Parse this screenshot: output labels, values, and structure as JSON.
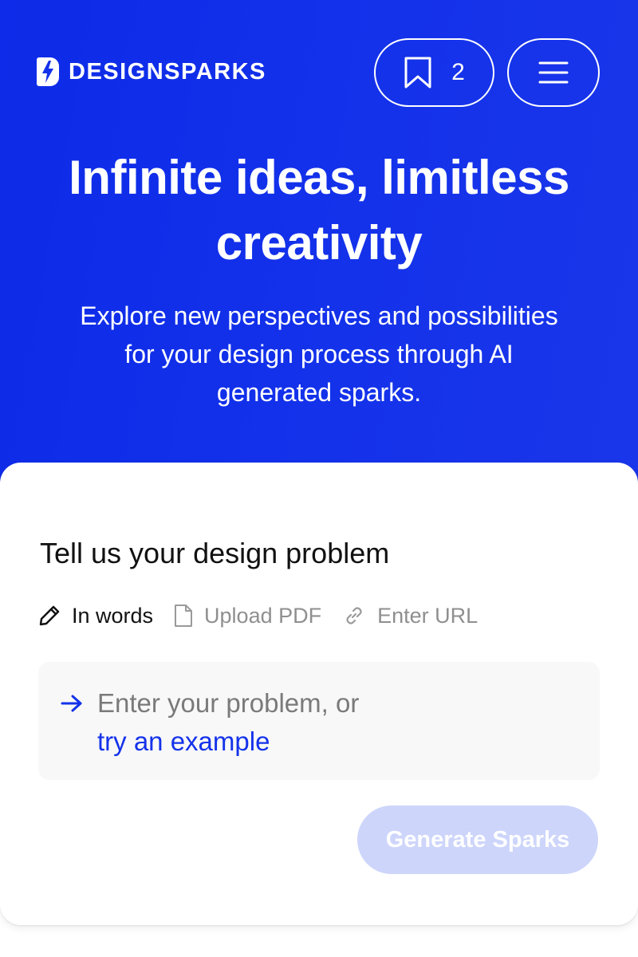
{
  "header": {
    "logo_text": "DESIGNSPARKS",
    "logo_icon": "lightning-bolt-icon",
    "saved_icon": "bookmark-icon",
    "saved_count": "2",
    "menu_icon": "hamburger-menu-icon"
  },
  "hero": {
    "title_line1": "Infinite ideas, limitless",
    "title_line2": "creativity",
    "subtitle_line1": "Explore new perspectives and possibilities",
    "subtitle_line2": "for your design process through AI",
    "subtitle_line3": "generated sparks."
  },
  "form": {
    "heading": "Tell us your design problem",
    "tabs": [
      {
        "label": "In words",
        "icon": "pencil-icon",
        "active": true
      },
      {
        "label": "Upload PDF",
        "icon": "document-icon",
        "active": false
      },
      {
        "label": "Enter URL",
        "icon": "link-icon",
        "active": false
      }
    ],
    "input_icon": "arrow-right-icon",
    "placeholder": "Enter your problem, or",
    "example_link": "try an example",
    "submit_label": "Generate Sparks"
  },
  "colors": {
    "brand_blue": "#1432ea",
    "button_disabled": "#cdd5fb",
    "input_background": "#f8f8f8"
  }
}
